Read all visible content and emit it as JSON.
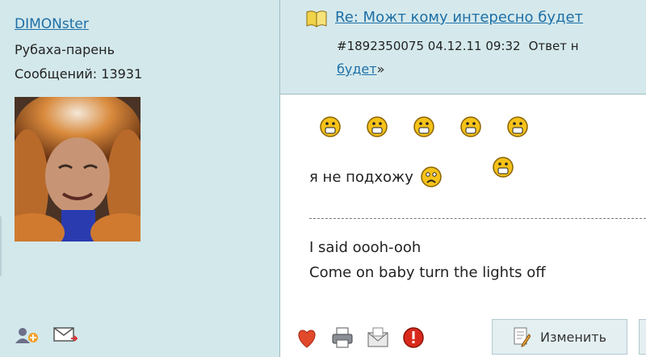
{
  "author": {
    "username": "DIMONster",
    "rank": "Рубаха-парень",
    "messages_label": "Сообщений: 13931",
    "actions": [
      {
        "icon": "add-friend-icon"
      },
      {
        "icon": "send-message-icon"
      }
    ]
  },
  "post": {
    "title": "Re: Можт кому интересно будет",
    "meta": "#1892350075 04.12.11 09:32",
    "reply_label": "Ответ н",
    "reply_link": "будет",
    "reply_suffix": "»",
    "body_line": "я не подхожу",
    "lyrics": [
      "I said oooh-ooh",
      "Come on baby turn the lights off"
    ],
    "smiley_row_icons": [
      "grin-smiley-icon",
      "grin-smiley-icon",
      "grin-smiley-icon",
      "grin-smiley-icon",
      "grin-smiley-icon"
    ],
    "action_icons": [
      "heart-icon",
      "printer-icon",
      "mail-icon",
      "warning-icon"
    ],
    "edit_label": "Изменить"
  },
  "colors": {
    "panel_bg": "#d3e8eb",
    "link": "#1d6fa6",
    "body_bg": "#ffffff"
  }
}
